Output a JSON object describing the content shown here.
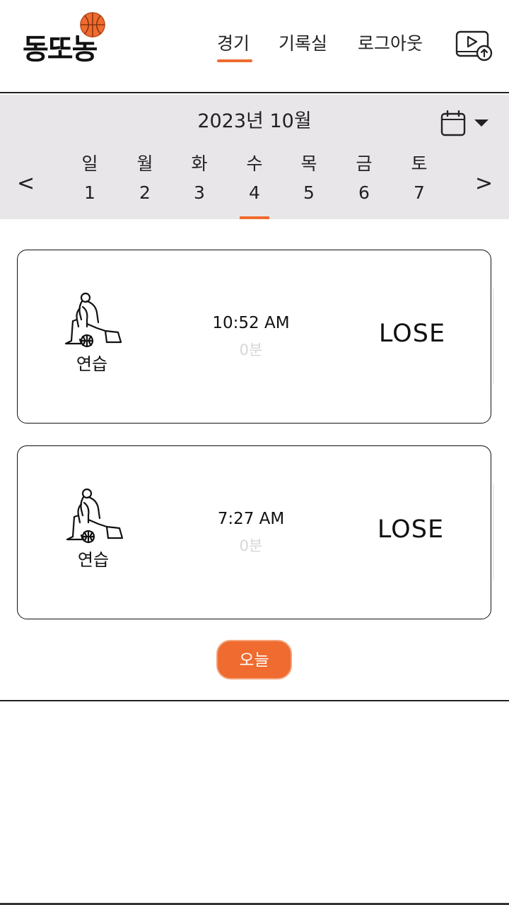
{
  "app": {
    "logo_text": "동또농"
  },
  "nav": {
    "games": "경기",
    "records": "기록실",
    "logout": "로그아웃",
    "active": "games"
  },
  "calendar": {
    "month_label": "2023년 10월",
    "prev": "<",
    "next": ">",
    "selected_day": "4",
    "days": [
      {
        "name": "일",
        "num": "1"
      },
      {
        "name": "월",
        "num": "2"
      },
      {
        "name": "화",
        "num": "3"
      },
      {
        "name": "수",
        "num": "4"
      },
      {
        "name": "목",
        "num": "5"
      },
      {
        "name": "금",
        "num": "6"
      },
      {
        "name": "토",
        "num": "7"
      }
    ]
  },
  "games": [
    {
      "type": "연습",
      "time": "10:52 AM",
      "duration": "0분",
      "result": "LOSE"
    },
    {
      "type": "연습",
      "time": "7:27 AM",
      "duration": "0분",
      "result": "LOSE"
    }
  ],
  "today_button": "오늘",
  "colors": {
    "accent": "#ef6b2f",
    "date_bar_bg": "#e9e6e9",
    "duration_text": "#d6d6d6"
  },
  "icons": {
    "logo_ball": "basketball-icon",
    "upload": "video-upload-icon",
    "calendar": "calendar-icon",
    "dropdown": "caret-down-icon",
    "player": "basketball-player-icon"
  }
}
